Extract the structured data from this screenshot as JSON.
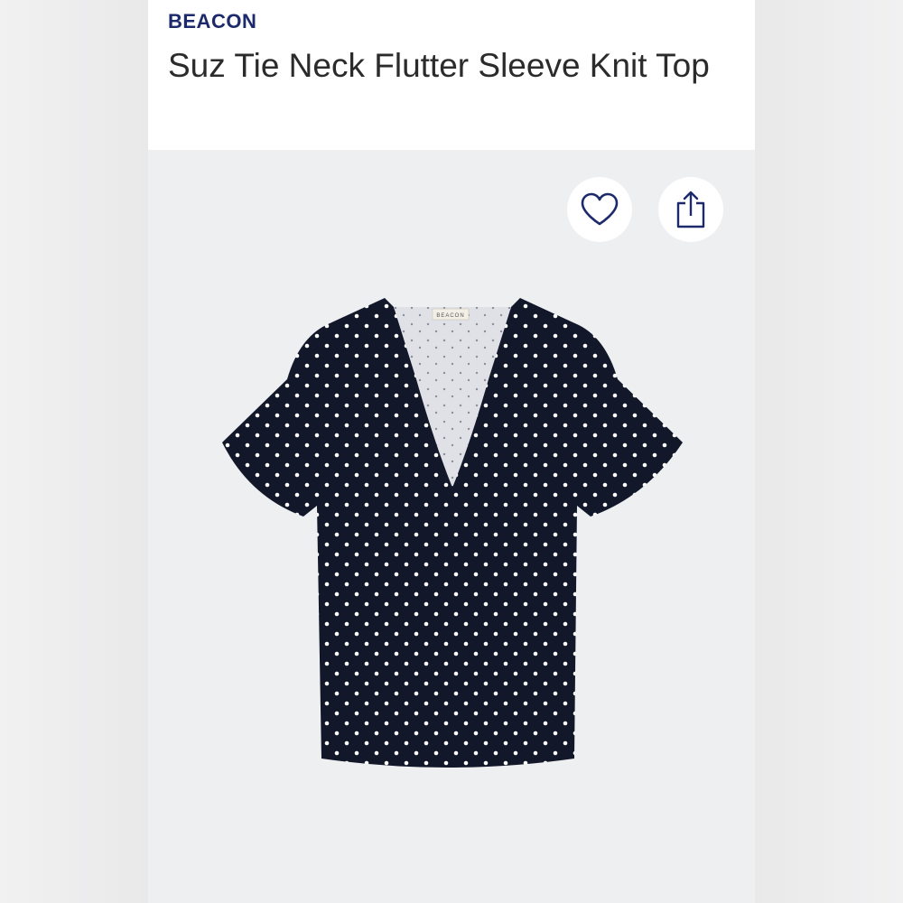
{
  "product": {
    "brand": "BEACON",
    "title": "Suz Tie Neck Flutter Sleeve Knit Top",
    "label_text": "BEACON"
  },
  "actions": {
    "favorite_icon": "heart-icon",
    "share_icon": "share-icon"
  },
  "colors": {
    "brand": "#1c2a6b",
    "garment": "#121729",
    "dot": "#ffffff",
    "background": "#eeeff1"
  }
}
